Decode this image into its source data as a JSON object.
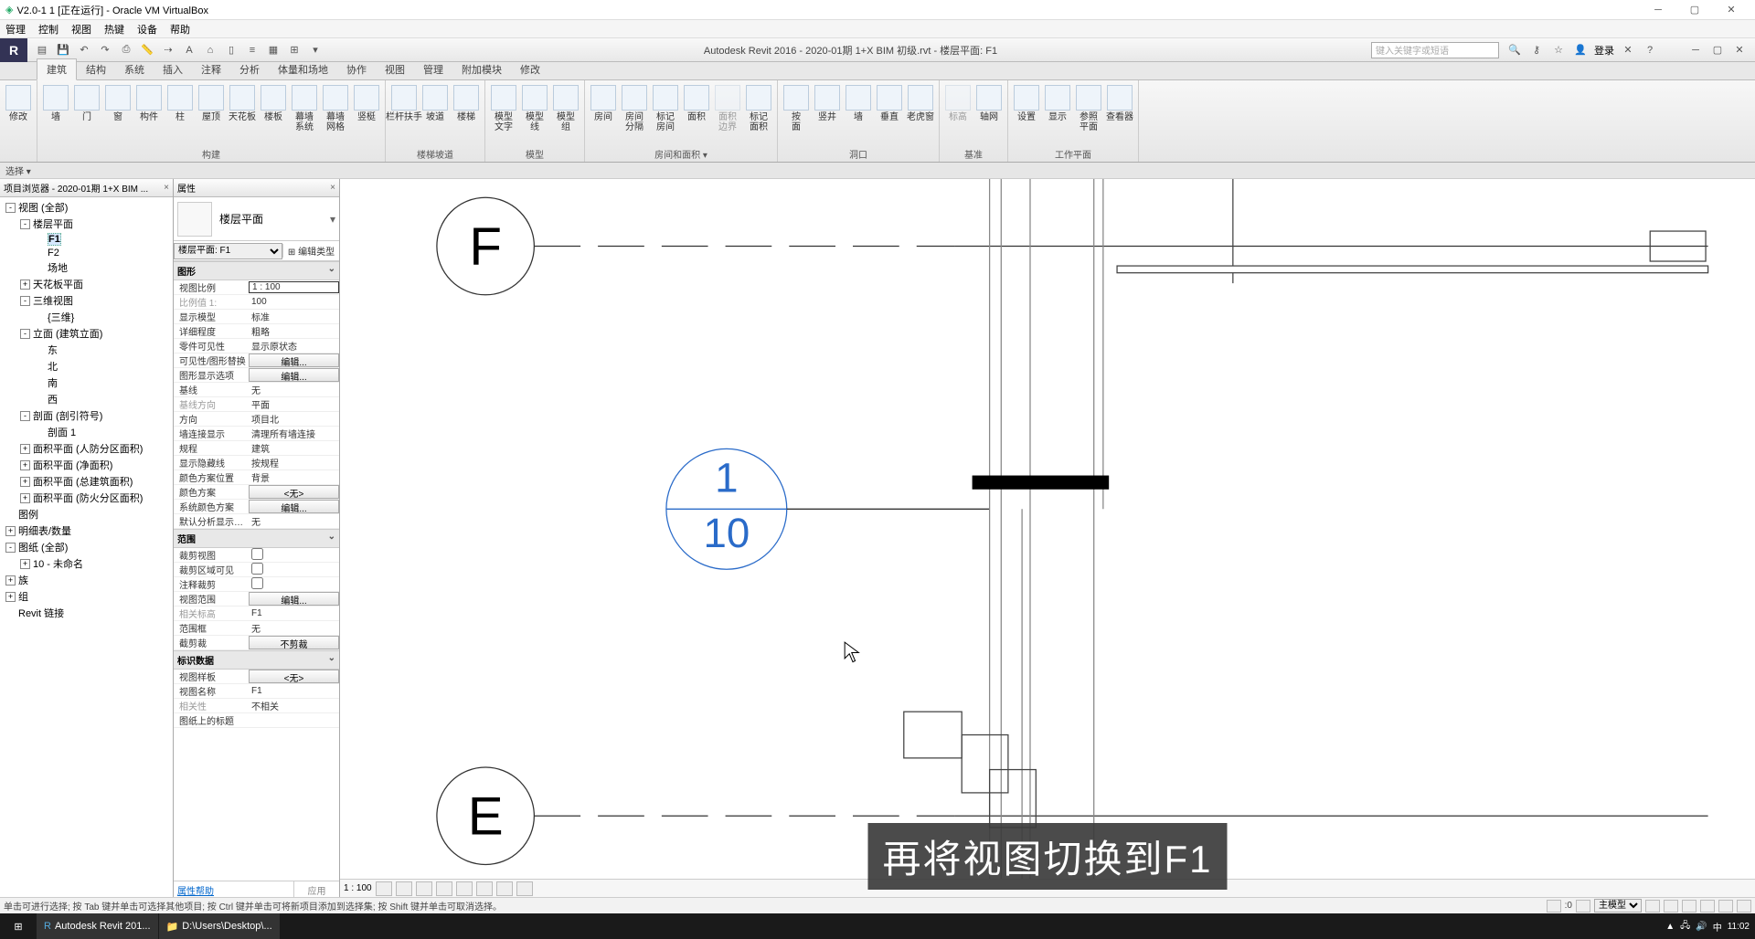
{
  "vbox": {
    "title": "V2.0-1 1 [正在运行] - Oracle VM VirtualBox",
    "menu": [
      "管理",
      "控制",
      "视图",
      "热键",
      "设备",
      "帮助"
    ]
  },
  "revit": {
    "title": "Autodesk Revit 2016 -     2020-01期 1+X BIM 初级.rvt - 楼层平面: F1",
    "search_placeholder": "键入关键字或短语",
    "login": "登录",
    "tabs": [
      "建筑",
      "结构",
      "系统",
      "插入",
      "注释",
      "分析",
      "体量和场地",
      "协作",
      "视图",
      "管理",
      "附加模块",
      "修改"
    ],
    "active_tab": "建筑",
    "selbar": "选择 ▾",
    "ribbon_groups": [
      {
        "label": "",
        "buttons": [
          {
            "l": "修改"
          }
        ]
      },
      {
        "label": "构建",
        "buttons": [
          {
            "l": "墙"
          },
          {
            "l": "门"
          },
          {
            "l": "窗"
          },
          {
            "l": "构件"
          },
          {
            "l": "柱"
          },
          {
            "l": "屋顶"
          },
          {
            "l": "天花板"
          },
          {
            "l": "楼板"
          },
          {
            "l": "幕墙\n系统"
          },
          {
            "l": "幕墙\n网格"
          },
          {
            "l": "竖梃"
          }
        ]
      },
      {
        "label": "楼梯坡道",
        "buttons": [
          {
            "l": "栏杆扶手"
          },
          {
            "l": "坡道"
          },
          {
            "l": "楼梯"
          }
        ]
      },
      {
        "label": "模型",
        "buttons": [
          {
            "l": "模型\n文字"
          },
          {
            "l": "模型\n线"
          },
          {
            "l": "模型\n组"
          }
        ]
      },
      {
        "label": "房间和面积 ▾",
        "buttons": [
          {
            "l": "房间"
          },
          {
            "l": "房间\n分隔"
          },
          {
            "l": "标记\n房间"
          },
          {
            "l": "面积"
          },
          {
            "l": "面积\n边界",
            "d": true
          },
          {
            "l": "标记\n面积"
          }
        ]
      },
      {
        "label": "洞口",
        "buttons": [
          {
            "l": "按\n面"
          },
          {
            "l": "竖井"
          },
          {
            "l": "墙"
          },
          {
            "l": "垂直"
          },
          {
            "l": "老虎窗"
          }
        ]
      },
      {
        "label": "基准",
        "buttons": [
          {
            "l": "标高",
            "d": true
          },
          {
            "l": "轴网"
          }
        ]
      },
      {
        "label": "工作平面",
        "buttons": [
          {
            "l": "设置"
          },
          {
            "l": "显示"
          },
          {
            "l": "参照\n平面"
          },
          {
            "l": "查看器"
          }
        ]
      }
    ],
    "status_text": "单击可进行选择; 按 Tab 键并单击可选择其他项目; 按 Ctrl 键并单击可将新项目添加到选择集; 按 Shift 键并单击可取消选择。",
    "status_num": ":0",
    "status_filter": "主模型",
    "viewbar_scale": "1 : 100"
  },
  "browser": {
    "title": "项目浏览器 - 2020-01期 1+X BIM ...",
    "tree": [
      {
        "ind": 0,
        "t": "-",
        "l": "视图 (全部)"
      },
      {
        "ind": 1,
        "t": "-",
        "l": "楼层平面"
      },
      {
        "ind": 2,
        "l": "F1",
        "bold": true,
        "sel": true
      },
      {
        "ind": 2,
        "l": "F2"
      },
      {
        "ind": 2,
        "l": "场地"
      },
      {
        "ind": 1,
        "t": "+",
        "l": "天花板平面"
      },
      {
        "ind": 1,
        "t": "-",
        "l": "三维视图"
      },
      {
        "ind": 2,
        "l": "{三维}"
      },
      {
        "ind": 1,
        "t": "-",
        "l": "立面 (建筑立面)"
      },
      {
        "ind": 2,
        "l": "东"
      },
      {
        "ind": 2,
        "l": "北"
      },
      {
        "ind": 2,
        "l": "南"
      },
      {
        "ind": 2,
        "l": "西"
      },
      {
        "ind": 1,
        "t": "-",
        "l": "剖面 (剖引符号)"
      },
      {
        "ind": 2,
        "l": "剖面 1"
      },
      {
        "ind": 1,
        "t": "+",
        "l": "面积平面 (人防分区面积)"
      },
      {
        "ind": 1,
        "t": "+",
        "l": "面积平面 (净面积)"
      },
      {
        "ind": 1,
        "t": "+",
        "l": "面积平面 (总建筑面积)"
      },
      {
        "ind": 1,
        "t": "+",
        "l": "面积平面 (防火分区面积)"
      },
      {
        "ind": 0,
        "l": "图例"
      },
      {
        "ind": 0,
        "t": "+",
        "l": "明细表/数量"
      },
      {
        "ind": 0,
        "t": "-",
        "l": "图纸 (全部)"
      },
      {
        "ind": 1,
        "t": "+",
        "l": "10 - 未命名"
      },
      {
        "ind": 0,
        "t": "+",
        "l": "族"
      },
      {
        "ind": 0,
        "t": "+",
        "l": "组"
      },
      {
        "ind": 0,
        "l": "Revit 链接"
      }
    ]
  },
  "props": {
    "title": "属性",
    "type_label": "楼层平面",
    "instance": "楼层平面: F1",
    "edit_type": "编辑类型",
    "help": "属性帮助",
    "apply": "应用",
    "groups": [
      {
        "cat": "图形",
        "rows": [
          {
            "k": "视图比例",
            "v": "1 : 100",
            "boxed": true
          },
          {
            "k": "比例值 1:",
            "v": "100",
            "dim": true
          },
          {
            "k": "显示模型",
            "v": "标准"
          },
          {
            "k": "详细程度",
            "v": "粗略"
          },
          {
            "k": "零件可见性",
            "v": "显示原状态"
          },
          {
            "k": "可见性/图形替换",
            "btn": "编辑..."
          },
          {
            "k": "图形显示选项",
            "btn": "编辑..."
          },
          {
            "k": "基线",
            "v": "无"
          },
          {
            "k": "基线方向",
            "v": "平面",
            "dim": true
          },
          {
            "k": "方向",
            "v": "项目北"
          },
          {
            "k": "墙连接显示",
            "v": "清理所有墙连接"
          },
          {
            "k": "规程",
            "v": "建筑"
          },
          {
            "k": "显示隐藏线",
            "v": "按规程"
          },
          {
            "k": "颜色方案位置",
            "v": "背景"
          },
          {
            "k": "颜色方案",
            "btn": "<无>"
          },
          {
            "k": "系统颜色方案",
            "btn": "编辑..."
          },
          {
            "k": "默认分析显示样...",
            "v": "无"
          }
        ]
      },
      {
        "cat": "范围",
        "rows": [
          {
            "k": "裁剪视图",
            "chk": false
          },
          {
            "k": "裁剪区域可见",
            "chk": false
          },
          {
            "k": "注释裁剪",
            "chk": false
          },
          {
            "k": "视图范围",
            "btn": "编辑..."
          },
          {
            "k": "相关标高",
            "v": "F1",
            "dim": true
          },
          {
            "k": "范围框",
            "v": "无"
          },
          {
            "k": "截剪裁",
            "btn": "不剪裁"
          }
        ]
      },
      {
        "cat": "标识数据",
        "rows": [
          {
            "k": "视图样板",
            "btn": "<无>"
          },
          {
            "k": "视图名称",
            "v": "F1"
          },
          {
            "k": "相关性",
            "v": "不相关",
            "dim": true
          },
          {
            "k": "图纸上的标题",
            "v": ""
          }
        ]
      }
    ]
  },
  "canvas": {
    "grid_top": "F",
    "grid_bottom": "E",
    "callout_num": "1",
    "callout_den": "10",
    "subtitle": "再将视图切换到F1"
  },
  "taskbar": {
    "apps": [
      "Autodesk Revit 201...",
      "D:\\Users\\Desktop\\..."
    ],
    "clock": "11:02"
  }
}
